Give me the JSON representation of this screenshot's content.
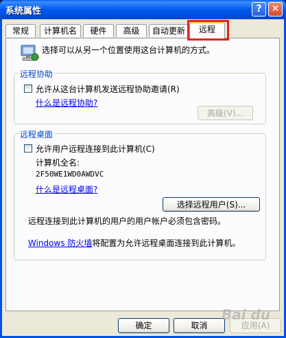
{
  "window": {
    "title": "系统属性",
    "help_symbol": "?",
    "close_symbol": "✕"
  },
  "tabs": [
    {
      "label": "常规"
    },
    {
      "label": "计算机名"
    },
    {
      "label": "硬件"
    },
    {
      "label": "高级"
    },
    {
      "label": "自动更新"
    },
    {
      "label": "远程",
      "active": true
    }
  ],
  "intro": {
    "text": "选择可以从另一个位置使用这台计算机的方式。",
    "icon": "computer-icon"
  },
  "remote_assistance": {
    "title": "远程协助",
    "checkbox_label": "允许从这台计算机发送远程协助邀请(R)",
    "checked": false,
    "help_link": "什么是远程协助?",
    "advanced_button": "高级(V)..."
  },
  "remote_desktop": {
    "title": "远程桌面",
    "checkbox_label": "允许用户远程连接到此计算机(C)",
    "checked": false,
    "full_name_label": "计算机全名:",
    "full_name_value": "2F50WE1WD0AWDVC",
    "help_link": "什么是远程桌面?",
    "select_users_button": "选择远程用户(S)...",
    "password_note": "远程连接到此计算机的用户的用户帐户必须包含密码。",
    "firewall_link": "Windows 防火墙",
    "firewall_text": "将配置为允许远程桌面连接到此计算机。"
  },
  "buttons": {
    "ok": "确定",
    "cancel": "取消",
    "apply": "应用(A)"
  },
  "watermark": "Bai du",
  "colors": {
    "title_bar": "#0058ee",
    "group_title": "#0046d5",
    "highlight": "#e8221e"
  }
}
